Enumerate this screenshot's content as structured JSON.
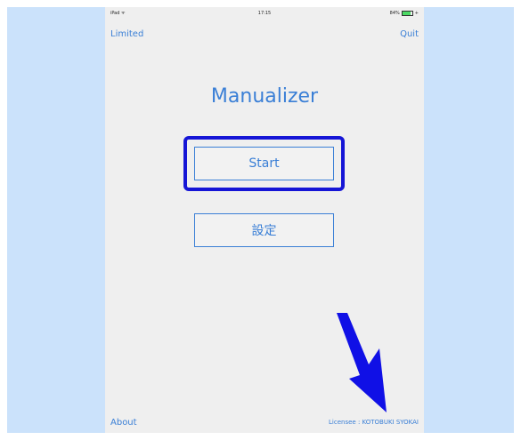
{
  "status_bar": {
    "carrier": "iPad ",
    "wifi_icon": "wifi-icon",
    "time": "17:15",
    "battery_text": "84%",
    "battery_level": 0.84
  },
  "nav": {
    "left_label": "Limited",
    "right_label": "Quit"
  },
  "app_title": "Manualizer",
  "buttons": {
    "start": "Start",
    "settings": "設定"
  },
  "footer": {
    "about": "About",
    "licensee": "Licensee : KOTOBUKI SYOKAI"
  },
  "colors": {
    "accent": "#3a7fd6",
    "highlight": "#1515d6",
    "outer_background": "#cbe2fb",
    "screen_background": "#efefef"
  }
}
